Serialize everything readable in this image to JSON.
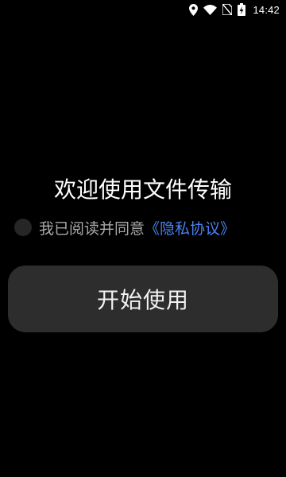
{
  "status_bar": {
    "time": "14:42",
    "icons": [
      "location-icon",
      "wifi-icon",
      "sim-off-icon",
      "battery-charging-icon"
    ]
  },
  "welcome": {
    "title": "欢迎使用文件传输"
  },
  "agreement": {
    "checked": false,
    "text": "我已阅读并同意",
    "link_label": "《隐私协议》"
  },
  "start_button": {
    "label": "开始使用"
  },
  "colors": {
    "background": "#000000",
    "link": "#4b82f0",
    "button_bg": "#2d2d2d",
    "secondary_text": "#a9a9a9"
  }
}
